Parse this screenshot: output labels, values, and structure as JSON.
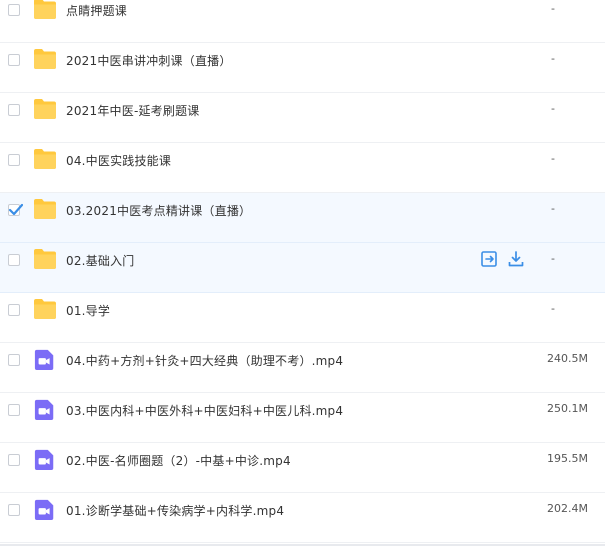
{
  "files": [
    {
      "name": "点睛押题课",
      "size": "-",
      "type": "folder"
    },
    {
      "name": "2021中医串讲冲刺课（直播）",
      "size": "-",
      "type": "folder"
    },
    {
      "name": "2021年中医-延考刷题课",
      "size": "-",
      "type": "folder"
    },
    {
      "name": "04.中医实践技能课",
      "size": "-",
      "type": "folder"
    },
    {
      "name": "03.2021中医考点精讲课（直播）",
      "size": "-",
      "type": "folder",
      "checked": true
    },
    {
      "name": "02.基础入门",
      "size": "-",
      "type": "folder",
      "hover": true
    },
    {
      "name": "01.导学",
      "size": "-",
      "type": "folder"
    },
    {
      "name": "04.中药+方剂+针灸+四大经典（助理不考）.mp4",
      "size": "240.5M",
      "type": "video"
    },
    {
      "name": "03.中医内科+中医外科+中医妇科+中医儿科.mp4",
      "size": "250.1M",
      "type": "video"
    },
    {
      "name": "02.中医-名师圈题（2）-中基+中诊.mp4",
      "size": "195.5M",
      "type": "video"
    },
    {
      "name": "01.诊断学基础+传染病学+内科学.mp4",
      "size": "202.4M",
      "type": "video"
    }
  ],
  "icons": {
    "folder": "folder-icon",
    "video": "video-file-icon",
    "share": "share-icon",
    "download": "download-icon",
    "check": "check-icon"
  },
  "colors": {
    "folder": "#ffc83d",
    "video": "#7b6cf6",
    "accent": "#3a8ee6",
    "selected_bg": "#f4f9ff"
  }
}
